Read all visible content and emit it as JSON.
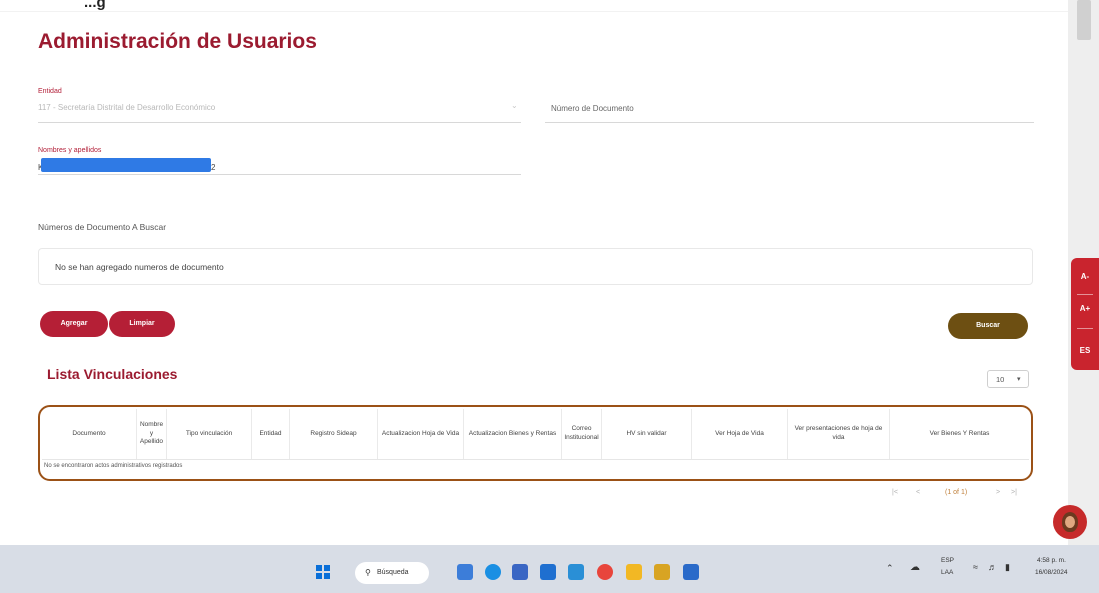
{
  "header": {
    "top_text": "...g",
    "title": "Administración de Usuarios"
  },
  "form": {
    "entidad_label": "Entidad",
    "entidad_value": "117 - Secretaría Distrital de Desarrollo Económico",
    "numero_documento_placeholder": "Número de Documento",
    "nombres_label": "Nombres y apellidos",
    "nombres_value_prefix": "K",
    "nombres_value_suffix": "2"
  },
  "documents": {
    "label": "Números de Documento A Buscar",
    "empty_text": "No se han agregado numeros de documento"
  },
  "buttons": {
    "agregar": "Agregar",
    "limpiar": "Limpiar",
    "buscar": "Buscar"
  },
  "list": {
    "title": "Lista Vinculaciones",
    "page_size": "10",
    "columns": [
      "Documento",
      "Nombre y Apellido",
      "Tipo vinculación",
      "Entidad",
      "Registro Sideap",
      "Actualizacion Hoja de Vida",
      "Actualizacion Bienes y Rentas",
      "Correo Institucional",
      "HV sin validar",
      "Ver Hoja de Vida",
      "Ver presentaciones de hoja de vida",
      "Ver Bienes Y Rentas"
    ],
    "empty_row": "No se encontraron actos administrativos registrados"
  },
  "pagination": {
    "first": "|<",
    "prev": "<",
    "info": "(1 of 1)",
    "next": ">",
    "last": ">|"
  },
  "accessibility": {
    "decrease": "A-",
    "increase": "A+",
    "language": "ES"
  },
  "taskbar": {
    "search_label": "Búsqueda",
    "lang_top": "ESP",
    "lang_bottom": "LAA",
    "time": "4:58 p. m.",
    "date": "16/08/2024",
    "app_colors": [
      "#3c7dd9",
      "#1a8fe3",
      "#3a66c4",
      "#1f6fd0",
      "#2a8fd6",
      "#e8453c",
      "#f2b824",
      "#d8a423",
      "#2a6ac9"
    ]
  }
}
